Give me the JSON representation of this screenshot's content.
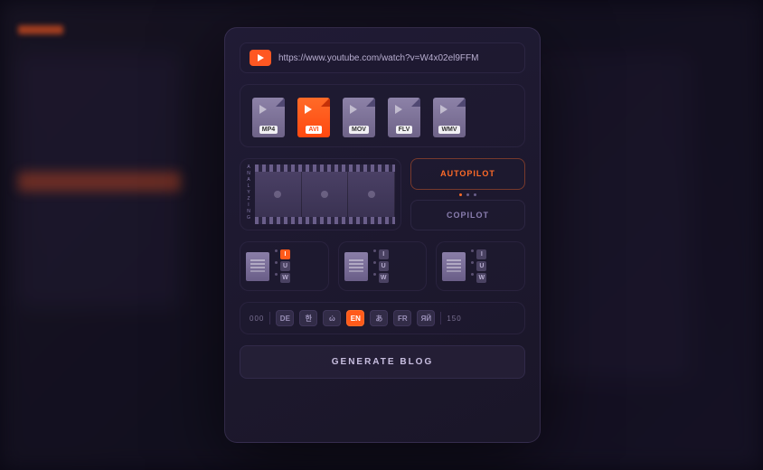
{
  "url": {
    "value": "https://www.youtube.com/watch?v=W4x02el9FFM"
  },
  "formats": [
    {
      "label": "MP4",
      "active": false
    },
    {
      "label": "AVI",
      "active": true
    },
    {
      "label": "MOV",
      "active": false
    },
    {
      "label": "FLV",
      "active": false
    },
    {
      "label": "WMV",
      "active": false
    }
  ],
  "analyzing_label": "ANALYZING",
  "modes": {
    "autopilot": "AUTOPILOT",
    "copilot": "COPILOT"
  },
  "templates": [
    {
      "styles": [
        {
          "g": "I",
          "lit": true
        },
        {
          "g": "U",
          "lit": false
        },
        {
          "g": "W",
          "lit": false
        }
      ]
    },
    {
      "styles": [
        {
          "g": "I",
          "lit": false
        },
        {
          "g": "U",
          "lit": false
        },
        {
          "g": "W",
          "lit": false
        }
      ]
    },
    {
      "styles": [
        {
          "g": "I",
          "lit": false
        },
        {
          "g": "U",
          "lit": false
        },
        {
          "g": "W",
          "lit": false
        }
      ]
    }
  ],
  "languages": {
    "left_count": "000",
    "right_count": "150",
    "items": [
      {
        "label": "DE",
        "active": false
      },
      {
        "label": "한",
        "active": false
      },
      {
        "label": "ώ",
        "active": false
      },
      {
        "label": "EN",
        "active": true
      },
      {
        "label": "あ",
        "active": false
      },
      {
        "label": "FR",
        "active": false
      },
      {
        "label": "ЯЙ",
        "active": false
      }
    ]
  },
  "cta": "GENERATE BLOG"
}
